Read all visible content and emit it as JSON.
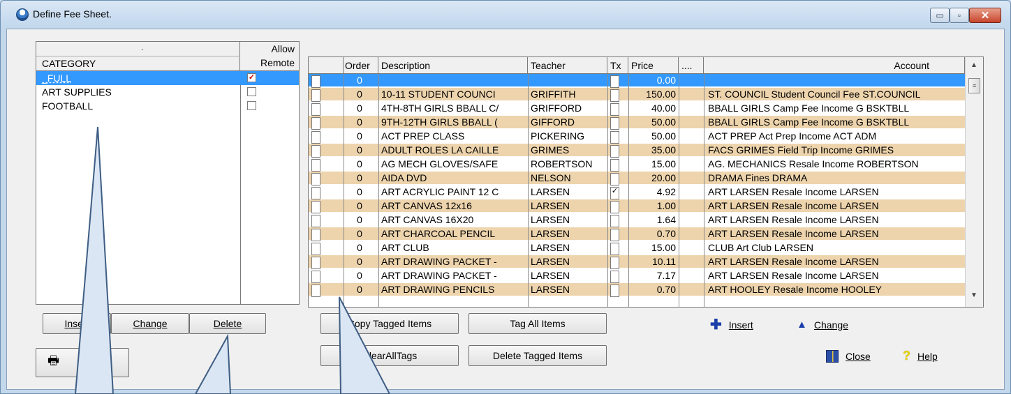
{
  "window": {
    "title": "Define Fee Sheet.",
    "controls": {
      "minimize": "▭",
      "maximize": "▫",
      "close": "✕"
    }
  },
  "category_grid": {
    "header_dot": ".",
    "col_category": "CATEGORY",
    "col_allow_line1": "Allow",
    "col_allow_line2": "Remote",
    "rows": [
      {
        "name": "_FULL",
        "allow_remote": "✓",
        "selected": true
      },
      {
        "name": "ART SUPPLIES",
        "allow_remote": "",
        "selected": false
      },
      {
        "name": "FOOTBALL",
        "allow_remote": "",
        "selected": false
      }
    ]
  },
  "category_buttons": {
    "insert": "Insert",
    "change": "Change",
    "delete": "Delete"
  },
  "fee_grid": {
    "columns": [
      "Order",
      "Description",
      "Teacher",
      "Tx",
      "Price",
      "....",
      "Account"
    ],
    "rows": [
      {
        "order": "0",
        "description": "",
        "teacher": "",
        "tx": "",
        "price": "0.00",
        "account": "",
        "selected": true
      },
      {
        "order": "0",
        "description": "10-11 STUDENT COUNCI",
        "teacher": "GRIFFITH",
        "tx": "",
        "price": "150.00",
        "account": "ST. COUNCIL Student Council Fee ST.COUNCIL"
      },
      {
        "order": "0",
        "description": "4TH-8TH GIRLS BBALL C/",
        "teacher": "GRIFFORD",
        "tx": "",
        "price": "40.00",
        "account": "BBALL GIRLS Camp Fee Income G BSKTBLL"
      },
      {
        "order": "0",
        "description": "9TH-12TH GIRLS BBALL (",
        "teacher": "GIFFORD",
        "tx": "",
        "price": "50.00",
        "account": "BBALL GIRLS Camp Fee Income G BSKTBLL"
      },
      {
        "order": "0",
        "description": "ACT PREP CLASS",
        "teacher": "PICKERING",
        "tx": "",
        "price": "50.00",
        "account": "ACT PREP Act Prep Income ACT ADM"
      },
      {
        "order": "0",
        "description": "ADULT ROLES LA CAILLE",
        "teacher": "GRIMES",
        "tx": "",
        "price": "35.00",
        "account": "FACS GRIMES Field Trip Income GRIMES"
      },
      {
        "order": "0",
        "description": "AG MECH GLOVES/SAFE",
        "teacher": "ROBERTSON",
        "tx": "",
        "price": "15.00",
        "account": "AG. MECHANICS Resale Income ROBERTSON"
      },
      {
        "order": "0",
        "description": "AIDA DVD",
        "teacher": "NELSON",
        "tx": "",
        "price": "20.00",
        "account": "DRAMA Fines DRAMA"
      },
      {
        "order": "0",
        "description": "ART ACRYLIC PAINT 12 C",
        "teacher": "LARSEN",
        "tx": "✓",
        "price": "4.92",
        "account": "ART LARSEN Resale Income LARSEN"
      },
      {
        "order": "0",
        "description": "ART CANVAS 12x16",
        "teacher": "LARSEN",
        "tx": "",
        "price": "1.00",
        "account": "ART LARSEN Resale Income LARSEN"
      },
      {
        "order": "0",
        "description": "ART CANVAS 16X20",
        "teacher": "LARSEN",
        "tx": "",
        "price": "1.64",
        "account": "ART LARSEN Resale Income LARSEN"
      },
      {
        "order": "0",
        "description": "ART CHARCOAL PENCIL",
        "teacher": "LARSEN",
        "tx": "",
        "price": "0.70",
        "account": "ART LARSEN Resale Income LARSEN"
      },
      {
        "order": "0",
        "description": "ART CLUB",
        "teacher": "LARSEN",
        "tx": "",
        "price": "15.00",
        "account": "CLUB Art Club LARSEN"
      },
      {
        "order": "0",
        "description": "ART DRAWING PACKET -",
        "teacher": "LARSEN",
        "tx": "",
        "price": "10.11",
        "account": "ART LARSEN Resale Income LARSEN"
      },
      {
        "order": "0",
        "description": "ART DRAWING PACKET -",
        "teacher": "LARSEN",
        "tx": "",
        "price": "7.17",
        "account": "ART LARSEN Resale Income LARSEN"
      },
      {
        "order": "0",
        "description": "ART DRAWING PENCILS",
        "teacher": "LARSEN",
        "tx": "",
        "price": "0.70",
        "account": "ART HOOLEY Resale Income HOOLEY"
      }
    ]
  },
  "fee_buttons": {
    "copy_tagged": "Copy Tagged Items",
    "tag_all": "Tag All Items",
    "clear_all_tags": "ClearAllTags",
    "delete_tagged": "Delete Tagged Items"
  },
  "actions": {
    "insert": "Insert",
    "change": "Change",
    "close": "Close",
    "help": "Help"
  },
  "colors": {
    "row_alt": "#edd4ad",
    "selection": "#3399ff",
    "callout": "#dbe6f4",
    "callout_border": "#3e5d83"
  },
  "icons": [
    "printer-icon",
    "plus-icon",
    "triangle-icon",
    "door-exit-icon",
    "question-icon"
  ]
}
